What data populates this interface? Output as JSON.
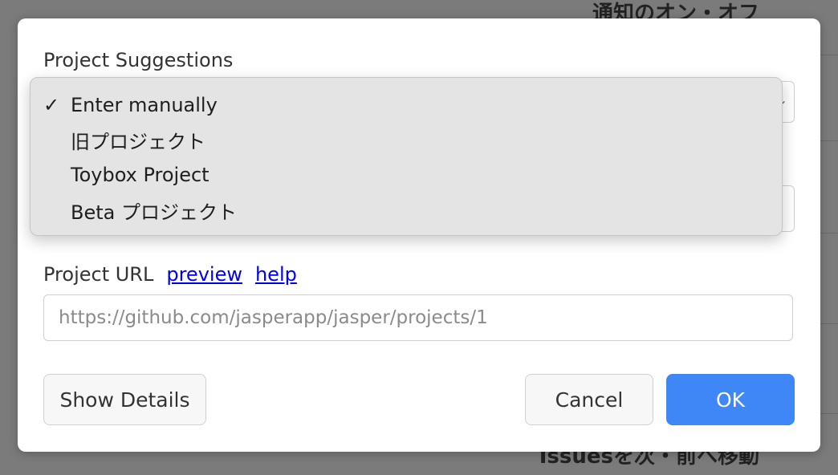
{
  "background": {
    "heading_top": "通知のオン・オフ",
    "heading_bottom": "Issuesを次・前へ移動"
  },
  "dialog": {
    "suggestions_label": "Project Suggestions",
    "dropdown": {
      "selected_mark": "✓",
      "options": [
        "Enter manually",
        "旧プロジェクト",
        "Toybox Project",
        "Beta プロジェクト"
      ],
      "selected_index": 0
    },
    "url_label": "Project URL",
    "preview_link": "preview",
    "help_link": "help",
    "url_placeholder": "https://github.com/jasperapp/jasper/projects/1",
    "buttons": {
      "details": "Show Details",
      "cancel": "Cancel",
      "ok": "OK"
    },
    "colors": {
      "primary": "#3f86f7",
      "link": "#0000ee"
    }
  }
}
